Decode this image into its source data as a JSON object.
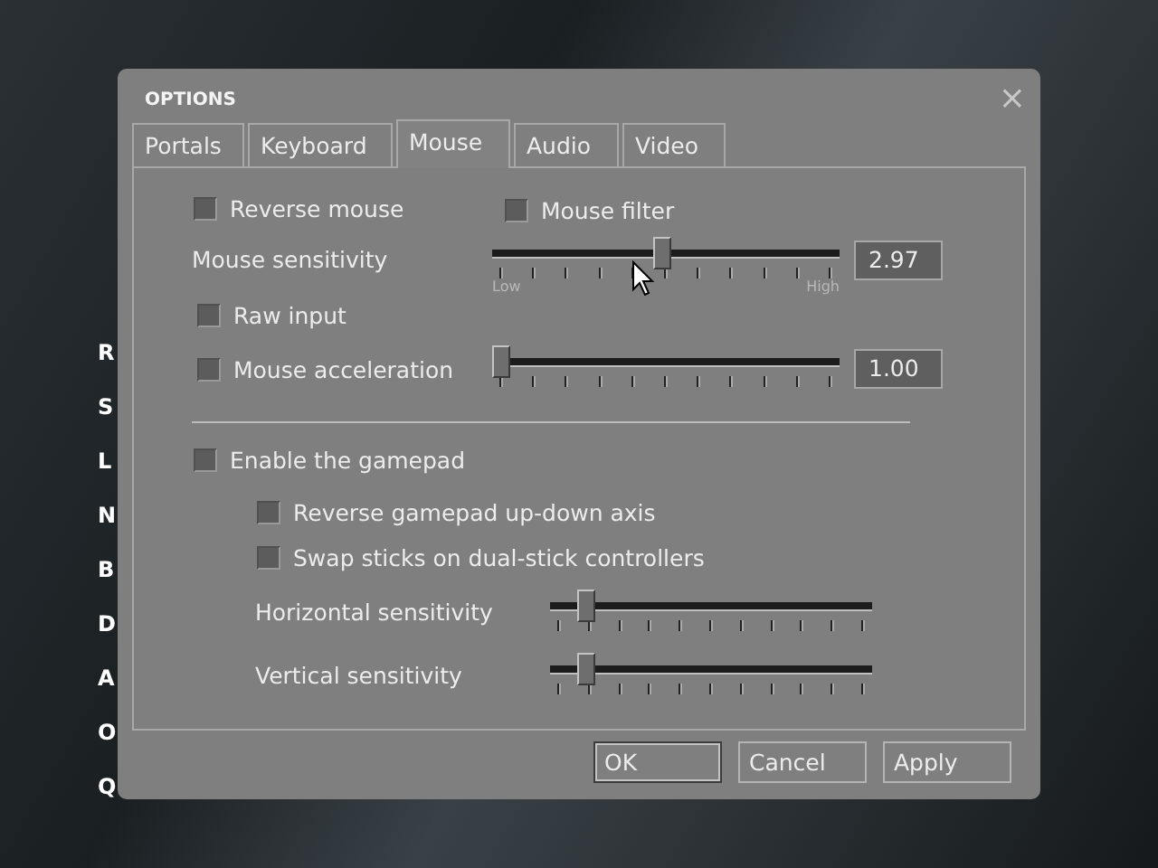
{
  "background_menu": {
    "items": [
      "R",
      "S",
      "L",
      "N",
      "B",
      "D",
      "A",
      "O",
      "Q"
    ]
  },
  "window": {
    "title": "OPTIONS",
    "close": "×"
  },
  "tabs": [
    {
      "label": "Portals",
      "selected": false
    },
    {
      "label": "Keyboard",
      "selected": false
    },
    {
      "label": "Mouse",
      "selected": true
    },
    {
      "label": "Audio",
      "selected": false
    },
    {
      "label": "Video",
      "selected": false
    }
  ],
  "mouse": {
    "reverse_mouse": {
      "label": "Reverse mouse",
      "checked": false
    },
    "mouse_filter": {
      "label": "Mouse filter",
      "checked": false
    },
    "sensitivity": {
      "label": "Mouse sensitivity",
      "level": 0.49,
      "low_label": "Low",
      "high_label": "High",
      "reading": "2.97"
    },
    "raw_input": {
      "label": "Raw input",
      "checked": false
    },
    "acceleration": {
      "label": "Mouse acceleration",
      "checked": false,
      "level": 0,
      "reading": "1.00"
    }
  },
  "gamepad": {
    "enable": {
      "label": "Enable the gamepad",
      "checked": false
    },
    "options": [
      {
        "label": "Reverse gamepad up-down axis",
        "checked": false
      },
      {
        "label": "Swap sticks on dual-stick controllers",
        "checked": false
      }
    ],
    "sliders": [
      {
        "label": "Horizontal sensitivity",
        "level": 0.09
      },
      {
        "label": "Vertical sensitivity",
        "level": 0.09
      }
    ]
  },
  "buttons": [
    "OK",
    "Cancel",
    "Apply"
  ]
}
